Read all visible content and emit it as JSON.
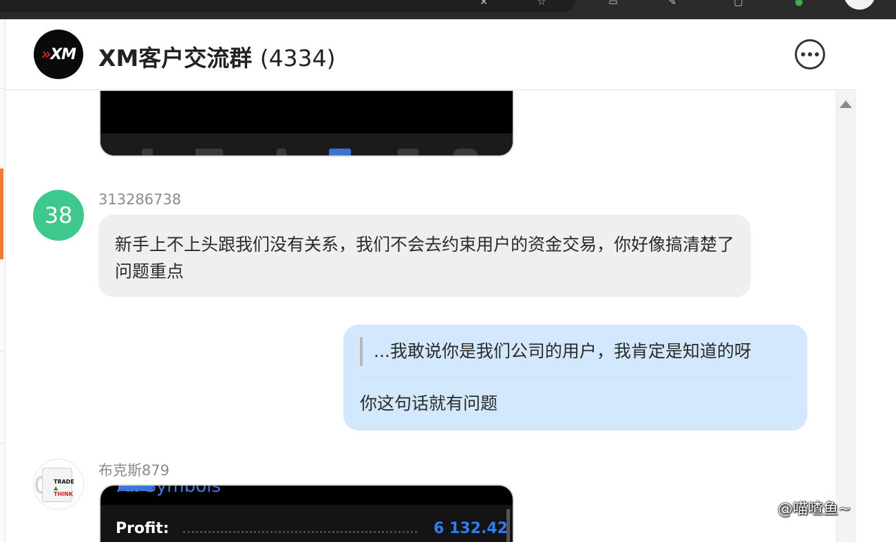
{
  "group": {
    "logo_text": "XM",
    "title": "XM客户交流群",
    "member_count": "(4334)"
  },
  "messages": [
    {
      "sender": "313286738",
      "avatar_text": "38",
      "avatar_color": "#3fc88e",
      "text": "新手上不上头跟我们没有关系，我们不会去约束用户的资金交易，你好像搞清楚了问题重点"
    },
    {
      "outgoing": true,
      "quote": "...我敢说你是我们公司的用户，我肯定是知道的呀",
      "text": "你这句话就有问题"
    },
    {
      "sender": "布克斯879",
      "image": {
        "header": "All Symbols",
        "profit_label": "Profit:",
        "profit_value": "6 132.42"
      }
    }
  ],
  "watermark": "@喵喳鱼~",
  "icons": [
    "more-icon",
    "scroll-up-icon",
    "avatar-mug-icon"
  ],
  "colors": {
    "outgoing_bubble": "#d3e8fd",
    "incoming_bubble": "#efefef",
    "accent": "#f07a3c",
    "profit": "#2f7df0"
  }
}
